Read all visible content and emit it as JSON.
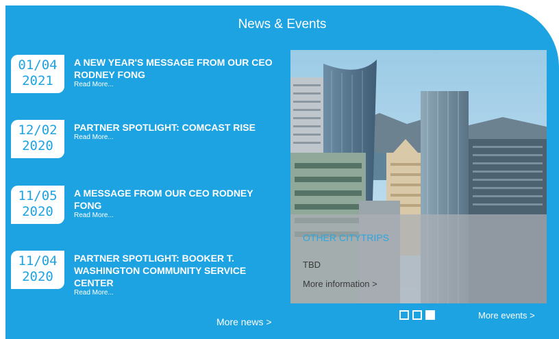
{
  "section": {
    "heading": "News & Events",
    "more_news": "More news >",
    "more_events": "More events >"
  },
  "news": [
    {
      "date_top": "01/04",
      "date_bottom": "2021",
      "title": "A NEW YEAR'S MESSAGE FROM OUR CEO RODNEY FONG",
      "read_more": "Read More..."
    },
    {
      "date_top": "12/02",
      "date_bottom": "2020",
      "title": "PARTNER SPOTLIGHT: COMCAST RISE",
      "read_more": "Read More..."
    },
    {
      "date_top": "11/05",
      "date_bottom": "2020",
      "title": "A MESSAGE FROM OUR CEO RODNEY FONG",
      "read_more": "Read More..."
    },
    {
      "date_top": "11/04",
      "date_bottom": "2020",
      "title": "PARTNER SPOTLIGHT: BOOKER T. WASHINGTON COMMUNITY SERVICE CENTER",
      "read_more": "Read More..."
    }
  ],
  "event": {
    "title": "OTHER CITYTRIPS",
    "description": "TBD",
    "link": "More information >"
  },
  "carousel": {
    "total": 3,
    "active": 3
  },
  "colors": {
    "panel_blue": "#1ea3e2",
    "text_white": "#ffffff"
  }
}
